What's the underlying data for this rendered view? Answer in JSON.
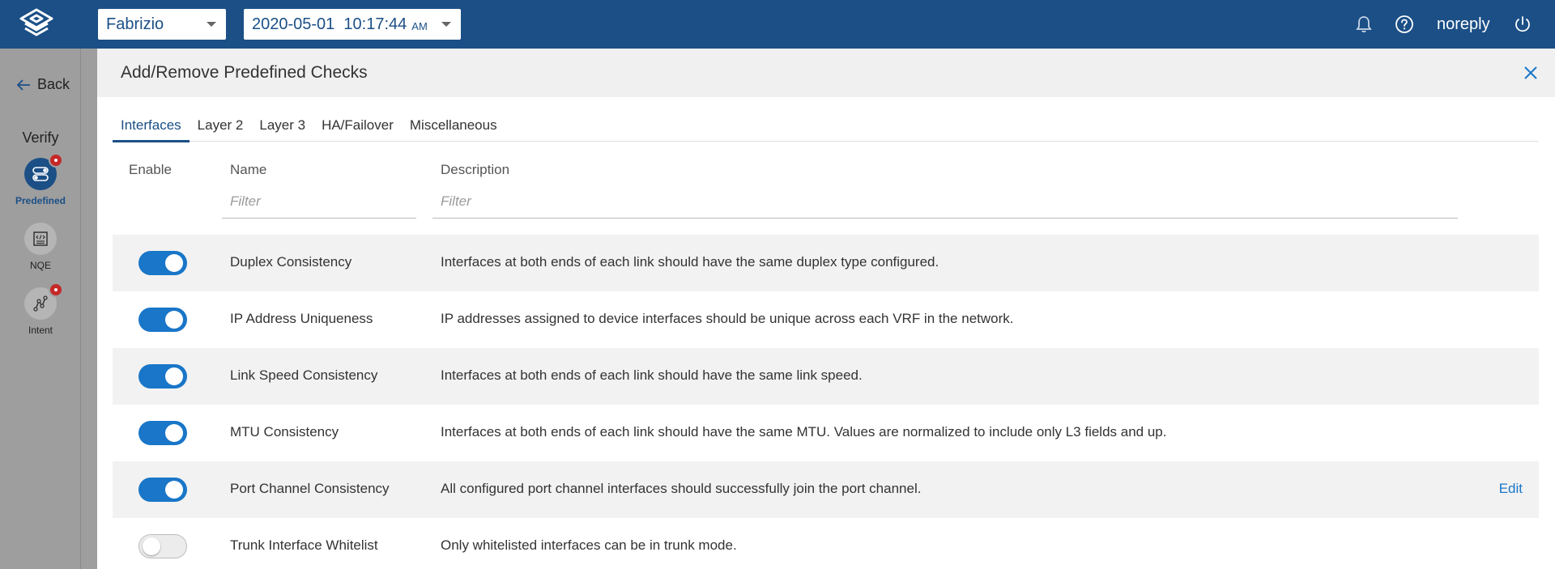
{
  "topbar": {
    "user_select": "Fabrizio",
    "datetime_select": "2020-05-01  10:17:44",
    "datetime_ampm": "AM",
    "username": "noreply"
  },
  "rail": {
    "back_label": "Back",
    "section_label": "Verify",
    "items": [
      {
        "label": "Predefined",
        "icon": "toggles-icon",
        "active": true,
        "badge": true
      },
      {
        "label": "NQE",
        "icon": "code-document-icon",
        "active": false,
        "badge": false
      },
      {
        "label": "Intent",
        "icon": "graph-nodes-icon",
        "active": false,
        "badge": true
      }
    ]
  },
  "panel": {
    "title": "Add/Remove Predefined Checks",
    "tabs": [
      {
        "label": "Interfaces",
        "active": true
      },
      {
        "label": "Layer 2",
        "active": false
      },
      {
        "label": "Layer 3",
        "active": false
      },
      {
        "label": "HA/Failover",
        "active": false
      },
      {
        "label": "Miscellaneous",
        "active": false
      }
    ],
    "columns": {
      "enable": "Enable",
      "name": "Name",
      "description": "Description"
    },
    "filters": {
      "name_placeholder": "Filter",
      "description_placeholder": "Filter"
    },
    "rows": [
      {
        "enabled": true,
        "name": "Duplex Consistency",
        "description": "Interfaces at both ends of each link should have the same duplex type configured.",
        "edit": ""
      },
      {
        "enabled": true,
        "name": "IP Address Uniqueness",
        "description": "IP addresses assigned to device interfaces should be unique across each VRF in the network.",
        "edit": ""
      },
      {
        "enabled": true,
        "name": "Link Speed Consistency",
        "description": "Interfaces at both ends of each link should have the same link speed.",
        "edit": ""
      },
      {
        "enabled": true,
        "name": "MTU Consistency",
        "description": "Interfaces at both ends of each link should have the same MTU. Values are normalized to include only L3 fields and up.",
        "edit": ""
      },
      {
        "enabled": true,
        "name": "Port Channel Consistency",
        "description": "All configured port channel interfaces should successfully join the port channel.",
        "edit": "Edit"
      },
      {
        "enabled": false,
        "name": "Trunk Interface Whitelist",
        "description": "Only whitelisted interfaces can be in trunk mode.",
        "edit": ""
      }
    ]
  },
  "colors": {
    "brand": "#1b4f86",
    "toggle_on": "#1976c8",
    "badge": "#c62828"
  }
}
